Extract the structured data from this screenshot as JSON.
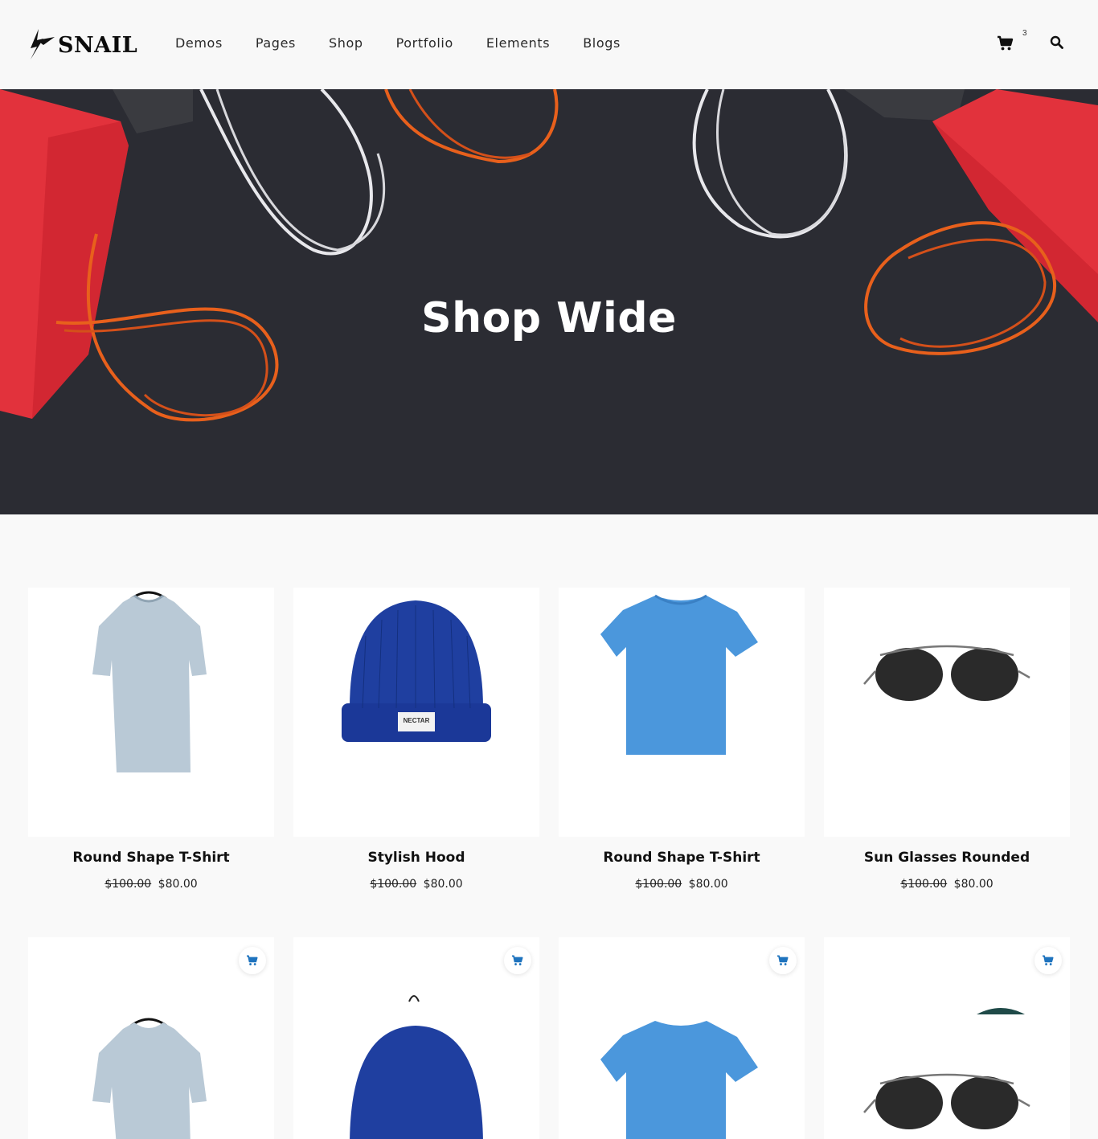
{
  "brand": {
    "name": "SNAIL"
  },
  "nav": [
    {
      "label": "Demos"
    },
    {
      "label": "Pages"
    },
    {
      "label": "Shop"
    },
    {
      "label": "Portfolio"
    },
    {
      "label": "Elements"
    },
    {
      "label": "Blogs"
    }
  ],
  "cart": {
    "count": "3"
  },
  "hero": {
    "title": "Shop Wide"
  },
  "products": [
    {
      "title": "Round Shape T-Shirt",
      "old_price": "$100.00",
      "price": "$80.00",
      "image": "grey-tshirt"
    },
    {
      "title": "Stylish Hood",
      "old_price": "$100.00",
      "price": "$80.00",
      "image": "blue-beanie",
      "tag": "NECTAR"
    },
    {
      "title": "Round Shape T-Shirt",
      "old_price": "$100.00",
      "price": "$80.00",
      "image": "blue-tshirt"
    },
    {
      "title": "Sun Glasses Rounded",
      "old_price": "$100.00",
      "price": "$80.00",
      "image": "sunglasses"
    }
  ],
  "colors": {
    "accent": "#1e73be",
    "hero_bg": "#2b2c33",
    "bag_red": "#e0303a",
    "rope_orange": "#e8601c"
  },
  "icons": {
    "cart": "cart-icon",
    "search": "search-icon",
    "add_to_cart": "add-to-cart-icon"
  }
}
